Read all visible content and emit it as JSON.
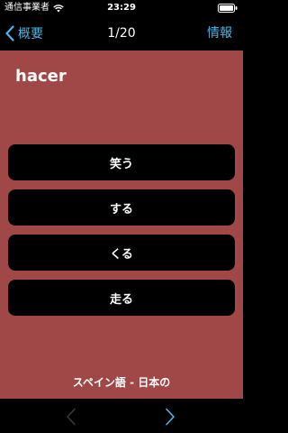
{
  "status_bar": {
    "carrier": "通信事業者",
    "time": "23:29"
  },
  "nav": {
    "back_label": "概要",
    "title": "1/20",
    "info_label": "情報"
  },
  "card": {
    "question": "hacer",
    "answers": [
      "笑う",
      "する",
      "くる",
      "走る"
    ]
  },
  "footer": {
    "label": "スペイン語  - 日本の"
  },
  "colors": {
    "accent": "#4db6e8",
    "card_background": "#a04747",
    "button_background": "#000000"
  },
  "icons": {
    "back": "chevron-left-icon",
    "prev": "chevron-left-icon",
    "next": "chevron-right-icon",
    "wifi": "wifi-icon",
    "battery": "battery-icon"
  }
}
